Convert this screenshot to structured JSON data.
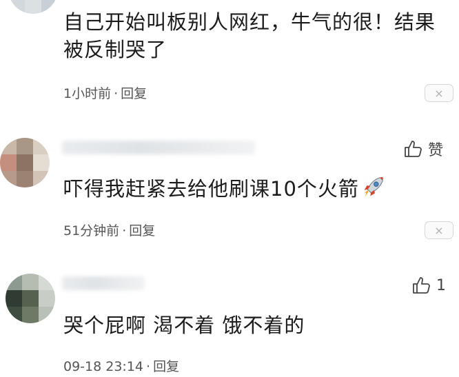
{
  "comments": [
    {
      "text": "自己开始叫板别人网红，牛气的很！结果被反制哭了",
      "meta_time": "1小时前",
      "meta_sep": "·",
      "reply_label": "回复",
      "close_symbol": "×"
    },
    {
      "text": "吓得我赶紧去给他刷课10个火箭",
      "meta_time": "51分钟前",
      "meta_sep": "·",
      "reply_label": "回复",
      "close_symbol": "×",
      "like_label": "赞"
    },
    {
      "text": "哭个屁啊 渴不着 饿不着的",
      "meta_time": "09-18 23:14",
      "meta_sep": "·",
      "reply_label": "回复",
      "like_count": "1"
    }
  ]
}
